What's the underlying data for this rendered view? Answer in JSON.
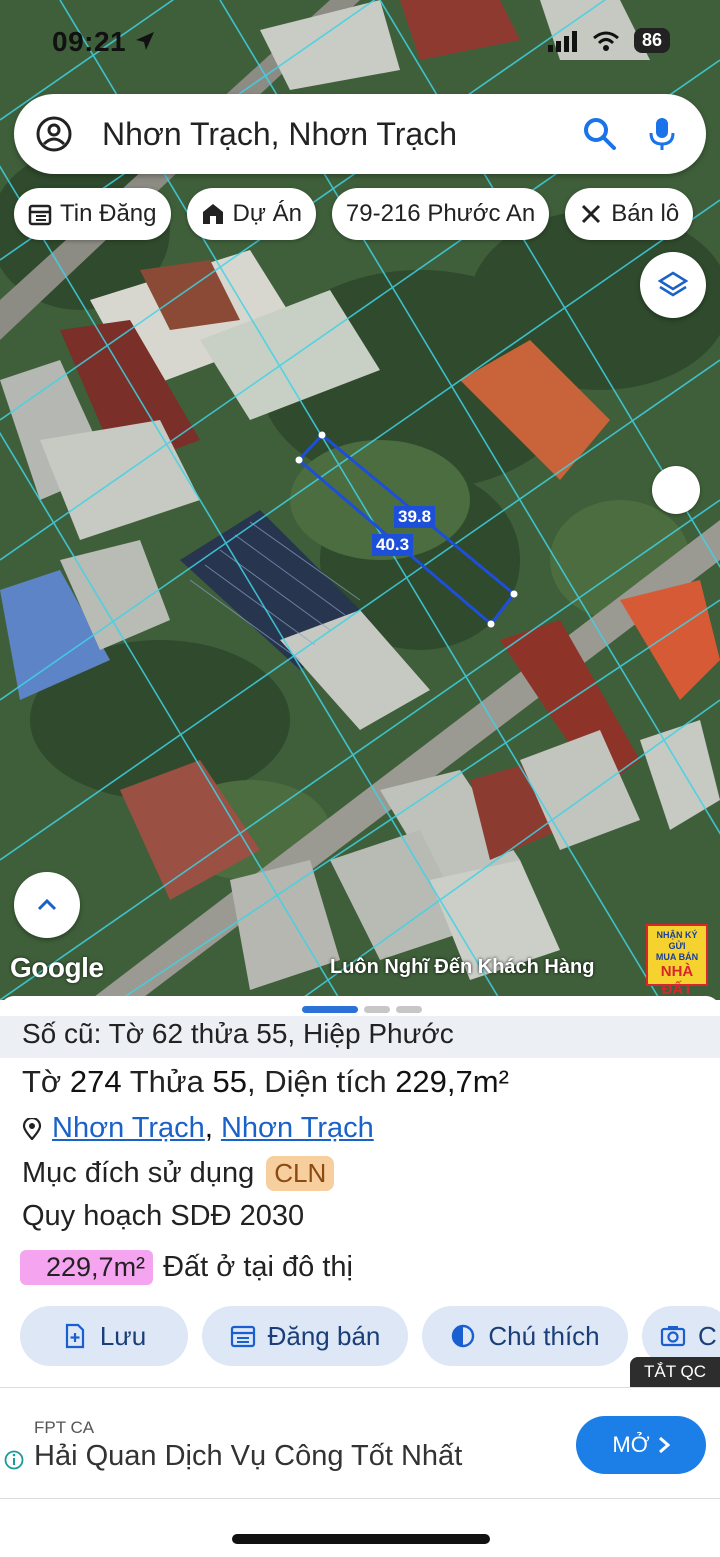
{
  "status": {
    "time": "09:21",
    "battery": "86"
  },
  "search": {
    "query": "Nhơn Trạch, Nhơn Trạch"
  },
  "chips": [
    {
      "label": "Tin Đăng",
      "icon": "calendar-icon"
    },
    {
      "label": "Dự Án",
      "icon": "building-icon"
    },
    {
      "label": "79-216 Phước An",
      "icon": ""
    },
    {
      "label": "Bán lô",
      "icon": "tools-icon"
    }
  ],
  "map": {
    "dimensions": {
      "side_a": "39.8",
      "side_b": "40.3"
    },
    "attribution": "Google",
    "watermark": "Luôn Nghĩ Đến Khách Hàng",
    "brand": {
      "line1": "NHẬN KÝ GỬI",
      "line2": "MUA BÁN",
      "line3": "NHÀ ĐẤT"
    }
  },
  "sheet": {
    "old_ref": "Số cũ: Tờ 62 thửa 55, Hiệp Phước",
    "parcel": {
      "to_label": "Tờ",
      "to": "274",
      "thua_label": "Thửa",
      "thua": "55",
      "area_label": "Diện tích",
      "area": "229,7m²"
    },
    "location": {
      "district": "Nhơn Trạch",
      "separator": ",",
      "commune": "Nhơn Trạch"
    },
    "purpose": {
      "label": "Mục đích sử dụng",
      "code": "CLN"
    },
    "plan": "Quy hoạch SDĐ 2030",
    "plan_area": {
      "value": "229,7m²",
      "desc": "Đất ở tại đô thị"
    },
    "actions": [
      {
        "label": "Lưu",
        "icon": "file-plus-icon"
      },
      {
        "label": "Đăng bán",
        "icon": "calendar-icon"
      },
      {
        "label": "Chú thích",
        "icon": "half-circle-icon"
      },
      {
        "label": "C",
        "icon": "camera-icon"
      }
    ],
    "close_ad": "TẮT QC"
  },
  "ad": {
    "sponsor": "FPT CA",
    "headline": "Hải Quan Dịch Vụ Công Tốt Nhất",
    "cta": "MỞ"
  },
  "colors": {
    "accent": "#1a62c8",
    "plot_outline": "#1e4fd8",
    "cln_tag": "#f7cf9e",
    "area_badge": "#f5a4f0"
  }
}
